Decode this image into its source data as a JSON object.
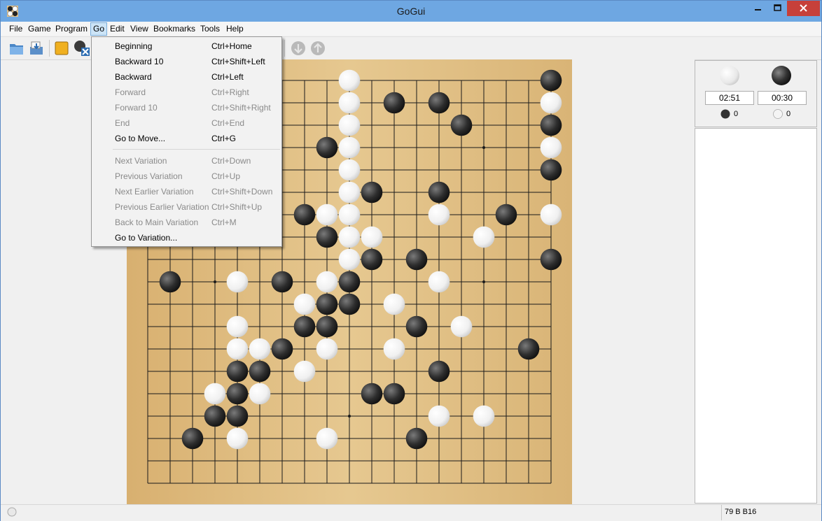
{
  "window": {
    "title": "GoGui"
  },
  "menubar": {
    "items": [
      "File",
      "Game",
      "Program",
      "Go",
      "Edit",
      "View",
      "Bookmarks",
      "Tools",
      "Help"
    ],
    "active": "Go"
  },
  "go_menu": {
    "items": [
      {
        "label": "Beginning",
        "shortcut": "Ctrl+Home",
        "enabled": true
      },
      {
        "label": "Backward 10",
        "shortcut": "Ctrl+Shift+Left",
        "enabled": true
      },
      {
        "label": "Backward",
        "shortcut": "Ctrl+Left",
        "enabled": true
      },
      {
        "label": "Forward",
        "shortcut": "Ctrl+Right",
        "enabled": false
      },
      {
        "label": "Forward 10",
        "shortcut": "Ctrl+Shift+Right",
        "enabled": false
      },
      {
        "label": "End",
        "shortcut": "Ctrl+End",
        "enabled": false
      },
      {
        "label": "Go to Move...",
        "shortcut": "Ctrl+G",
        "enabled": true
      },
      {
        "label": "Next Variation",
        "shortcut": "Ctrl+Down",
        "enabled": false
      },
      {
        "label": "Previous Variation",
        "shortcut": "Ctrl+Up",
        "enabled": false
      },
      {
        "label": "Next Earlier Variation",
        "shortcut": "Ctrl+Shift+Down",
        "enabled": false
      },
      {
        "label": "Previous Earlier Variation",
        "shortcut": "Ctrl+Shift+Up",
        "enabled": false
      },
      {
        "label": "Back to Main Variation",
        "shortcut": "Ctrl+M",
        "enabled": false
      },
      {
        "label": "Go to Variation...",
        "shortcut": "",
        "enabled": true
      }
    ]
  },
  "toolbar": {
    "icons": [
      "open-icon",
      "save-icon",
      "new-game-icon",
      "close-game-icon",
      "play-icon",
      "stop-icon"
    ]
  },
  "clock": {
    "white_time": "02:51",
    "black_time": "00:30",
    "black_captures": "0",
    "white_captures": "0"
  },
  "status": {
    "position": "79 B B16"
  },
  "board": {
    "size": 19,
    "colors": {
      "wood": "#e2bf85",
      "line": "#1a1a1a",
      "black_stone": "#2a2a2a",
      "white_stone": "#f3f3f3"
    },
    "black": [
      [
        18,
        0
      ],
      [
        18,
        2
      ],
      [
        18,
        4
      ],
      [
        11,
        1
      ],
      [
        13,
        1
      ],
      [
        14,
        2
      ],
      [
        8,
        3
      ],
      [
        13,
        5
      ],
      [
        10,
        5
      ],
      [
        16,
        6
      ],
      [
        7,
        6
      ],
      [
        8,
        7
      ],
      [
        10,
        8
      ],
      [
        12,
        8
      ],
      [
        18,
        8
      ],
      [
        1,
        9
      ],
      [
        6,
        9
      ],
      [
        9,
        9
      ],
      [
        8,
        10
      ],
      [
        9,
        10
      ],
      [
        7,
        11
      ],
      [
        8,
        11
      ],
      [
        12,
        11
      ],
      [
        6,
        12
      ],
      [
        17,
        12
      ],
      [
        4,
        13
      ],
      [
        5,
        13
      ],
      [
        13,
        13
      ],
      [
        10,
        14
      ],
      [
        11,
        14
      ],
      [
        4,
        14
      ],
      [
        3,
        15
      ],
      [
        4,
        15
      ],
      [
        2,
        16
      ],
      [
        12,
        16
      ]
    ],
    "white": [
      [
        9,
        0
      ],
      [
        9,
        1
      ],
      [
        9,
        2
      ],
      [
        9,
        3
      ],
      [
        9,
        4
      ],
      [
        9,
        5
      ],
      [
        18,
        1
      ],
      [
        18,
        3
      ],
      [
        13,
        6
      ],
      [
        8,
        6
      ],
      [
        9,
        6
      ],
      [
        9,
        7
      ],
      [
        10,
        7
      ],
      [
        9,
        8
      ],
      [
        18,
        6
      ],
      [
        15,
        7
      ],
      [
        4,
        9
      ],
      [
        8,
        9
      ],
      [
        13,
        9
      ],
      [
        7,
        10
      ],
      [
        11,
        10
      ],
      [
        4,
        11
      ],
      [
        14,
        11
      ],
      [
        4,
        12
      ],
      [
        5,
        12
      ],
      [
        8,
        12
      ],
      [
        11,
        12
      ],
      [
        7,
        13
      ],
      [
        3,
        14
      ],
      [
        5,
        14
      ],
      [
        13,
        15
      ],
      [
        15,
        15
      ],
      [
        4,
        16
      ],
      [
        8,
        16
      ]
    ]
  }
}
